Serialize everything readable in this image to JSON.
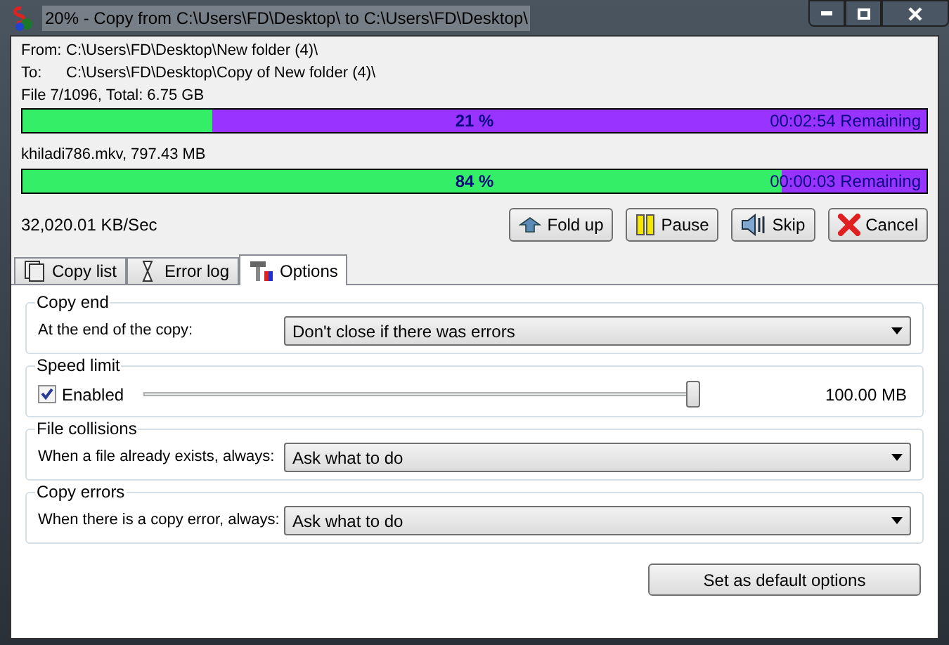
{
  "window": {
    "title": "20% - Copy from C:\\Users\\FD\\Desktop\\ to C:\\Users\\FD\\Desktop\\"
  },
  "info": [
    {
      "label": "From:",
      "value": "C:\\Users\\FD\\Desktop\\New folder (4)\\"
    },
    {
      "label": "To:",
      "value": "C:\\Users\\FD\\Desktop\\Copy of New folder (4)\\"
    }
  ],
  "total": {
    "text": "File 7/1096, Total: 6.75 GB",
    "level": 0.21,
    "percent": "21 %",
    "remaining": "00:02:54 Remaining"
  },
  "current": {
    "text": "khiladi786.mkv, 797.43 MB",
    "level": 0.84,
    "percent": "84 %",
    "remaining": "00:00:03 Remaining"
  },
  "speed": "32,020.01 KB/Sec",
  "buttons": [
    {
      "kind": "foldup",
      "label": "Fold up"
    },
    {
      "kind": "pause",
      "label": "Pause"
    },
    {
      "kind": "skip",
      "label": "Skip"
    },
    {
      "kind": "cancel",
      "label": "Cancel"
    }
  ],
  "tabs": [
    {
      "kind": "list",
      "label": "Copy list",
      "selected": false
    },
    {
      "kind": "log",
      "label": "Error log",
      "selected": false
    },
    {
      "kind": "options",
      "label": "Options",
      "selected": true
    }
  ],
  "groups": [
    {
      "kind": "select",
      "title": "Copy end",
      "label": "At the end of the copy:",
      "value": "Don't close if there was errors"
    },
    {
      "kind": "slider",
      "title": "Speed limit",
      "label": "Enabled",
      "checked": true,
      "level": 0.99,
      "reading": "100.00 MB"
    },
    {
      "kind": "select",
      "title": "File collisions",
      "label": "When a file already exists, always:",
      "value": "Ask what to do"
    },
    {
      "kind": "select",
      "title": "Copy errors",
      "label": "When there is a copy error, always:",
      "value": "Ask what to do"
    }
  ],
  "default_button": "Set as default options"
}
